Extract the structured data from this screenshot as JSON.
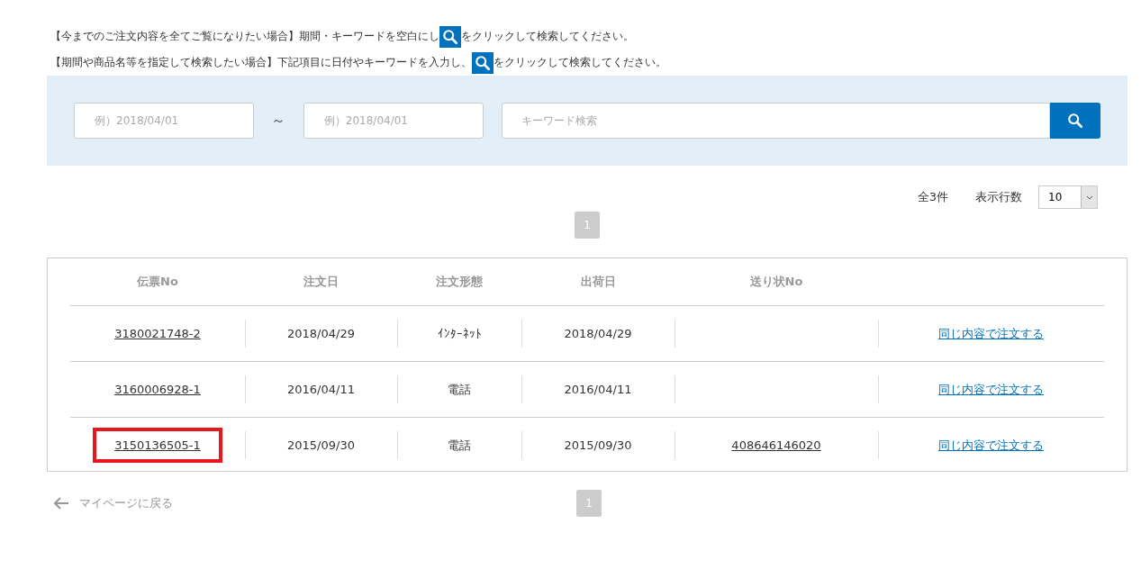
{
  "notes": [
    {
      "before": "【今までのご注文内容を全てご覧になりたい場合】期間・キーワードを空白にし",
      "after": "をクリックして検索してください。"
    },
    {
      "before": "【期間や商品名等を指定して検索したい場合】下記項目に日付やキーワードを入力し、",
      "after": "をクリックして検索してください。"
    }
  ],
  "search": {
    "date_from": {
      "placeholder": "例）2018/04/01"
    },
    "separator": "～",
    "date_to": {
      "placeholder": "例）2018/04/01"
    },
    "keyword": {
      "placeholder": "キーワード検索"
    }
  },
  "summary": {
    "total": "全3件",
    "rows_label": "表示行数",
    "rows_value": "10"
  },
  "pager_top": [
    {
      "label": "1",
      "selected": true
    }
  ],
  "table": {
    "columns": [
      "伝票No",
      "注文日",
      "注文形態",
      "出荷日",
      "送り状No"
    ],
    "rows": [
      {
        "slip_no": "3180021748-2",
        "order_date": "2018/04/29",
        "order_type": "ｲﾝﾀｰﾈｯﾄ",
        "ship_date": "2018/04/29",
        "action": "同じ内容で注文する",
        "highlighted": false
      },
      {
        "slip_no": "3160006928-1",
        "order_date": "2016/04/11",
        "order_type": "電話",
        "ship_date": "2016/04/11",
        "action": "同じ内容で注文する",
        "highlighted": false
      },
      {
        "slip_no": "3150136505-1",
        "order_date": "2015/09/30",
        "order_type": "電話",
        "ship_date": "2015/09/30",
        "invoice_no": "408646146020",
        "action": "同じ内容で注文する",
        "highlighted": true
      }
    ]
  },
  "back_link": "マイページに戻る",
  "pager_bottom": [
    {
      "label": "1",
      "selected": true
    }
  ]
}
